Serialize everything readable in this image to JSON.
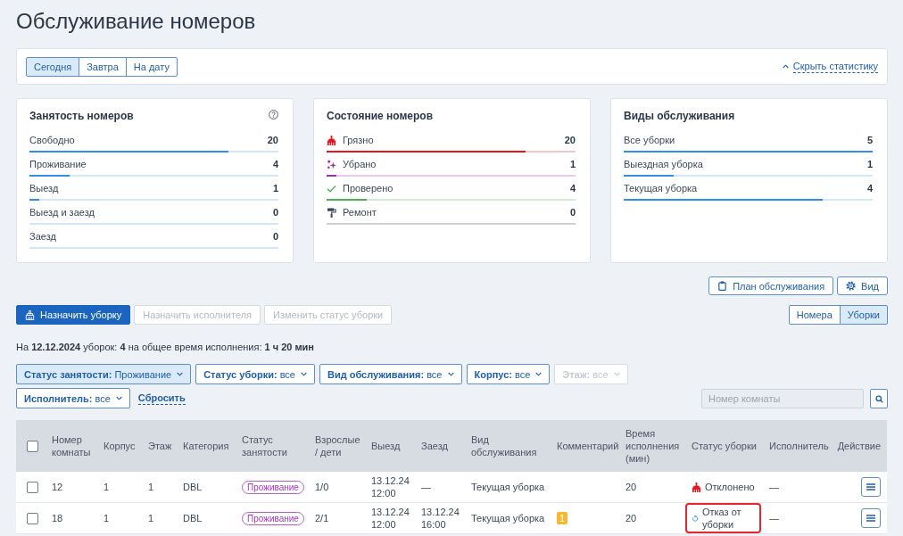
{
  "title": "Обслуживание номеров",
  "date_tabs": [
    {
      "label": "Сегодня",
      "selected": true
    },
    {
      "label": "Завтра",
      "selected": false
    },
    {
      "label": "На дату",
      "selected": false
    }
  ],
  "stats_toggle": {
    "label": "Скрыть статистику",
    "expanded": true
  },
  "stat_cards": [
    {
      "title": "Занятость номеров",
      "help": true,
      "rows": [
        {
          "label": "Свободно",
          "value": "20",
          "level": 0.8
        },
        {
          "label": "Проживание",
          "value": "4",
          "level": 0.16
        },
        {
          "label": "Выезд",
          "value": "1",
          "level": 0.04
        },
        {
          "label": "Выезд и заезд",
          "value": "0",
          "level": 0
        },
        {
          "label": "Заезд",
          "value": "0",
          "level": 0
        }
      ]
    },
    {
      "title": "Состояние номеров",
      "help": false,
      "rows": [
        {
          "kind": "dirty",
          "label": "Грязно",
          "value": "20",
          "level": 0.8,
          "color": "#e3161b"
        },
        {
          "kind": "cleaned",
          "label": "Убрано",
          "value": "1",
          "level": 0.04,
          "color": "#9b2fae"
        },
        {
          "kind": "inspected",
          "label": "Проверено",
          "value": "4",
          "level": 0.16,
          "color": "#4caf50"
        },
        {
          "kind": "repair",
          "label": "Ремонт",
          "value": "0",
          "level": 0,
          "color": "#3a4555"
        }
      ]
    },
    {
      "title": "Виды обслуживания",
      "help": false,
      "rows": [
        {
          "label": "Все уборки",
          "value": "5",
          "level": 1
        },
        {
          "label": "Выездная уборка",
          "value": "1",
          "level": 0.2
        },
        {
          "label": "Текущая уборка",
          "value": "4",
          "level": 0.8
        }
      ]
    }
  ],
  "view_buttons": [
    {
      "kind": "plan",
      "label": "План обслуживания"
    },
    {
      "kind": "view",
      "label": "Вид"
    }
  ],
  "actions": [
    {
      "kind": "primary",
      "label": "Назначить уборку",
      "disabled": false
    },
    {
      "kind": "secondary",
      "label": "Назначить исполнителя",
      "disabled": true
    },
    {
      "kind": "secondary",
      "label": "Изменить статус уборки",
      "disabled": true
    }
  ],
  "mode_tabs": [
    {
      "label": "Номера",
      "selected": false
    },
    {
      "label": "Уборки",
      "selected": true
    }
  ],
  "summary": "На **12.12.2024** уборок: **4** на общее время исполнения: **1 ч 20 мин**",
  "filters": [
    {
      "label": "Статус занятости:",
      "value": "Проживание",
      "active": true,
      "disabled": false
    },
    {
      "label": "Статус уборки:",
      "value": "все",
      "active": false,
      "disabled": false
    },
    {
      "label": "Вид обслуживания:",
      "value": "все",
      "active": false,
      "disabled": false
    },
    {
      "label": "Корпус:",
      "value": "все",
      "active": false,
      "disabled": false
    },
    {
      "label": "Этаж:",
      "value": "все",
      "active": false,
      "disabled": true
    },
    {
      "label": "Исполнитель:",
      "value": "все",
      "active": false,
      "disabled": false
    }
  ],
  "reset_link": "Сбросить",
  "room_search": {
    "placeholder": "Номер комнаты"
  },
  "table": {
    "select_all": {
      "checked": false
    },
    "columns": [
      "Номер комнаты",
      "Корпус",
      "Этаж",
      "Категория",
      "Статус занятости",
      "Взрослые / дети",
      "Выезд",
      "Заезд",
      "Вид обслуживания",
      "Комментарий",
      "Время исполнения (мин)",
      "Статус уборки",
      "Исполнитель",
      "Действие"
    ],
    "rows": [
      {
        "checked": false,
        "room": "12",
        "building": "1",
        "floor": "1",
        "category": "DBL",
        "occupancy": "Проживание",
        "guests": "1/0",
        "departure": "13.12.24 12:00",
        "arrival": "—",
        "service": "Текущая уборка",
        "time": "20",
        "cleaning_status": {
          "kind": "declined",
          "label": "Отклонено",
          "highlighted": false
        },
        "executor": "—"
      },
      {
        "checked": false,
        "room": "18",
        "building": "1",
        "floor": "1",
        "category": "DBL",
        "occupancy": "Проживание",
        "guests": "2/1",
        "departure": "13.12.24 12:00",
        "arrival": "13.12.24 16:00",
        "service": "Текущая уборка",
        "comments": "1",
        "time": "20",
        "cleaning_status": {
          "kind": "refused",
          "label": "Отказ от уборки",
          "highlighted": true
        },
        "executor": "—"
      }
    ]
  }
}
